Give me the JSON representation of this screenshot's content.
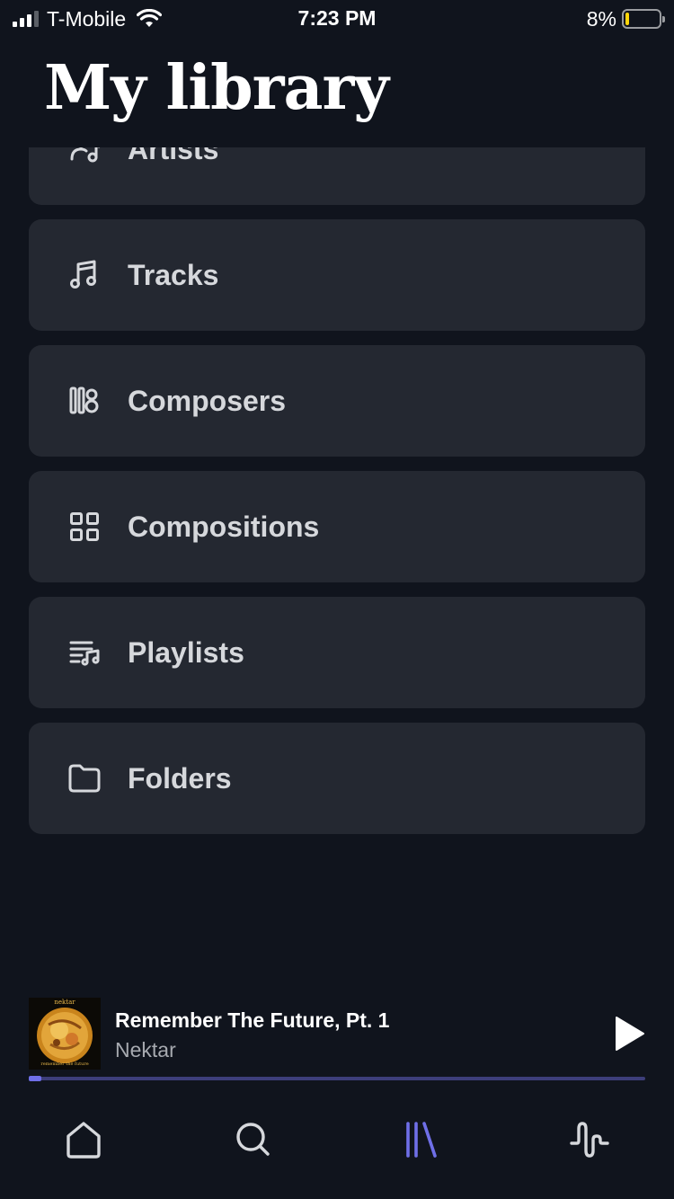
{
  "status_bar": {
    "carrier": "T-Mobile",
    "time": "7:23 PM",
    "battery": "8%",
    "battery_level": 0.08,
    "signal_bars": 3
  },
  "header": {
    "title": "My library"
  },
  "library": {
    "items": [
      {
        "label": "Artists",
        "icon": "artists-icon"
      },
      {
        "label": "Tracks",
        "icon": "music-note-icon"
      },
      {
        "label": "Composers",
        "icon": "composers-icon"
      },
      {
        "label": "Compositions",
        "icon": "grid-icon"
      },
      {
        "label": "Playlists",
        "icon": "playlist-icon"
      },
      {
        "label": "Folders",
        "icon": "folder-icon"
      }
    ]
  },
  "now_playing": {
    "title": "Remember The Future, Pt. 1",
    "artist": "Nektar",
    "album_art_top": "nektar",
    "album_art_bottom": "remember the future",
    "progress": 0.02
  },
  "tabs": [
    {
      "name": "home",
      "icon": "home-icon",
      "active": false
    },
    {
      "name": "search",
      "icon": "search-icon",
      "active": false
    },
    {
      "name": "library",
      "icon": "library-icon",
      "active": true
    },
    {
      "name": "activity",
      "icon": "waveform-icon",
      "active": false
    }
  ],
  "colors": {
    "background": "#10141d",
    "card": "#242831",
    "accent": "#6f6fe8",
    "inactive_icon": "#d6d8dc"
  }
}
